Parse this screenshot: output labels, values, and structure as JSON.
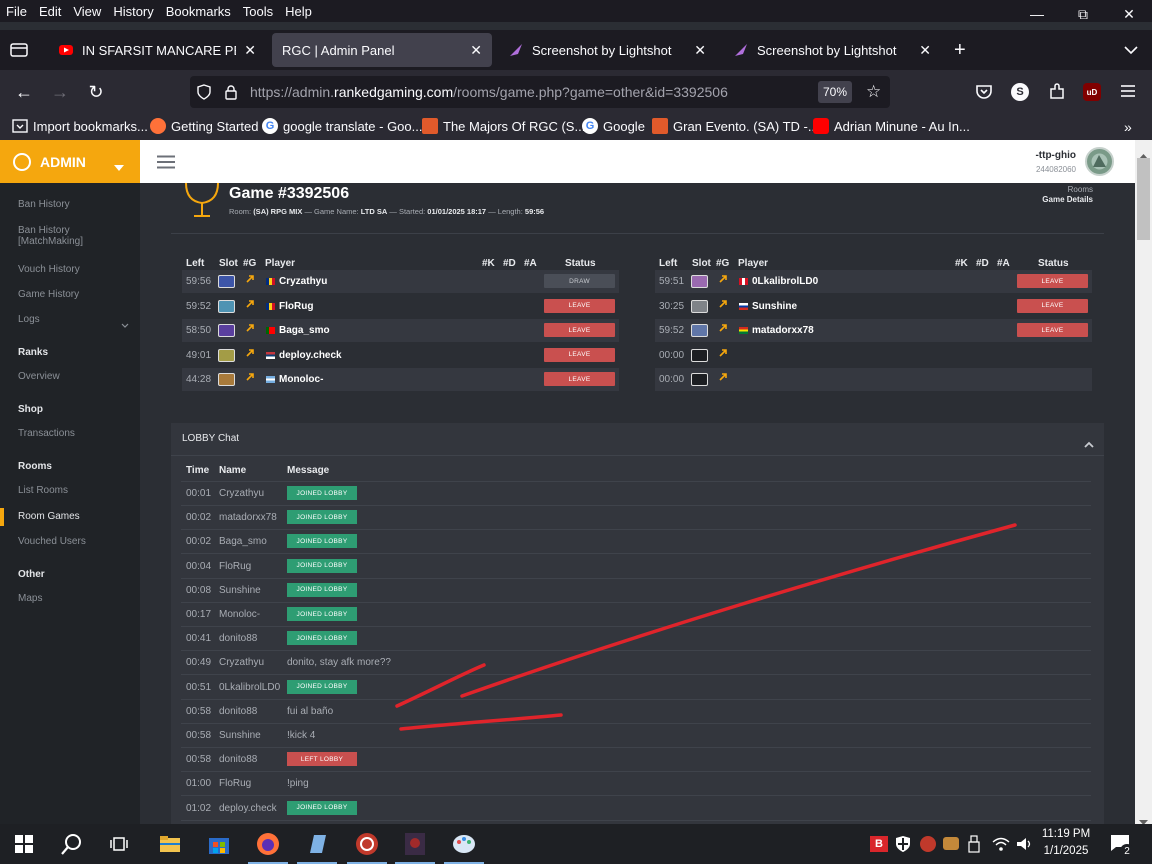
{
  "menubar": {
    "items": [
      "File",
      "Edit",
      "View",
      "History",
      "Bookmarks",
      "Tools",
      "Help"
    ]
  },
  "tabs": [
    {
      "label": "IN SFARSIT MANCARE PESTE M",
      "icon": "youtube-icon"
    },
    {
      "label": "RGC | Admin Panel",
      "icon": "none",
      "active": true
    },
    {
      "label": "Screenshot by Lightshot",
      "icon": "lightshot-icon"
    },
    {
      "label": "Screenshot by Lightshot",
      "icon": "lightshot-icon"
    }
  ],
  "url": {
    "prefix": "https://admin.",
    "host": "rankedgaming.com",
    "path": "/rooms/game.php?game=other&id=3392506",
    "zoom": "70%"
  },
  "toolbar": {
    "profile_initial": "S"
  },
  "bookmarks": [
    {
      "label": "Import bookmarks...",
      "icon": "import-icon",
      "color": "#fbfbfe"
    },
    {
      "label": "Getting Started",
      "icon": "firefox-icon",
      "color": "#ff7139"
    },
    {
      "label": "google translate - Goo...",
      "icon": "google-icon",
      "color": "#4285f4"
    },
    {
      "label": "The Majors Of RGC (S...",
      "icon": "rgc-icon",
      "color": "#e05a2b"
    },
    {
      "label": "Google",
      "icon": "google-icon",
      "color": "#4285f4"
    },
    {
      "label": "Gran Evento. (SA) TD -...",
      "icon": "rgc-icon",
      "color": "#e05a2b"
    },
    {
      "label": "Adrian Minune - Au In...",
      "icon": "youtube-icon",
      "color": "#ff0000"
    }
  ],
  "sidebar": {
    "brand": "ADMIN",
    "items": [
      {
        "label": "Ban History",
        "type": "item"
      },
      {
        "label": "Ban History",
        "label2": "[MatchMaking]",
        "type": "item"
      },
      {
        "label": "Vouch History",
        "type": "item"
      },
      {
        "label": "Game History",
        "type": "item"
      },
      {
        "label": "Logs",
        "type": "item"
      },
      {
        "label": "Ranks",
        "type": "head"
      },
      {
        "label": "Overview",
        "type": "item"
      },
      {
        "label": "Shop",
        "type": "head"
      },
      {
        "label": "Transactions",
        "type": "item"
      },
      {
        "label": "Rooms",
        "type": "head"
      },
      {
        "label": "List Rooms",
        "type": "item"
      },
      {
        "label": "Room Games",
        "type": "item",
        "active": true
      },
      {
        "label": "Vouched Users",
        "type": "item"
      },
      {
        "label": "Other",
        "type": "head"
      },
      {
        "label": "Maps",
        "type": "item"
      }
    ]
  },
  "user": {
    "name": "-ttp-ghio",
    "id": "244082060"
  },
  "breadcrumb": {
    "parent": "Rooms",
    "current": "Game Details"
  },
  "game": {
    "title": "Game #3392506",
    "room_label": "Room:",
    "room": "(SA) RPG MIX",
    "name_label": "Game Name:",
    "name": "LTD SA",
    "started_label": "Started:",
    "started": "01/01/2025 18:17",
    "length_label": "Length:",
    "length": "59:56"
  },
  "table_headers": {
    "left": "Left",
    "slot": "Slot",
    "g": "#G",
    "player": "Player",
    "k": "#K",
    "d": "#D",
    "a": "#A",
    "status": "Status"
  },
  "team1": [
    {
      "left": "59:56",
      "slot_color": "#3d55a8",
      "flag": "ro",
      "player": "Cryzathyu",
      "status": "DRAW"
    },
    {
      "left": "59:52",
      "slot_color": "#4e93b3",
      "flag": "ro",
      "player": "FloRug",
      "status": "LEAVE"
    },
    {
      "left": "58:50",
      "slot_color": "#5a3f9e",
      "flag": "pt",
      "player": "Baga_smo",
      "status": "LEAVE"
    },
    {
      "left": "49:01",
      "slot_color": "#a39c46",
      "flag": "rs",
      "player": "deploy.check",
      "status": "LEAVE"
    },
    {
      "left": "44:28",
      "slot_color": "#a87a3b",
      "flag": "ar",
      "player": "Monoloc-",
      "status": "LEAVE"
    }
  ],
  "team2": [
    {
      "left": "59:51",
      "slot_color": "#9a6ab0",
      "flag": "pe",
      "player": "0LkalibrolLD0",
      "status": "LEAVE"
    },
    {
      "left": "30:25",
      "slot_color": "#7f8388",
      "flag": "ru",
      "player": "Sunshine",
      "status": "LEAVE"
    },
    {
      "left": "59:52",
      "slot_color": "#6076a8",
      "flag": "bo",
      "player": "matadorxx78",
      "status": "LEAVE"
    },
    {
      "left": "00:00",
      "slot_color": "#1c1e22",
      "flag": "",
      "player": "",
      "status": ""
    },
    {
      "left": "00:00",
      "slot_color": "#1c1e22",
      "flag": "",
      "player": "",
      "status": ""
    }
  ],
  "lobby": {
    "title": "LOBBY Chat",
    "headers": {
      "time": "Time",
      "name": "Name",
      "message": "Message"
    },
    "rows": [
      {
        "time": "00:01",
        "name": "Cryzathyu",
        "type": "joined",
        "message": "JOINED LOBBY"
      },
      {
        "time": "00:02",
        "name": "matadorxx78",
        "type": "joined",
        "message": "JOINED LOBBY"
      },
      {
        "time": "00:02",
        "name": "Baga_smo",
        "type": "joined",
        "message": "JOINED LOBBY"
      },
      {
        "time": "00:04",
        "name": "FloRug",
        "type": "joined",
        "message": "JOINED LOBBY"
      },
      {
        "time": "00:08",
        "name": "Sunshine",
        "type": "joined",
        "message": "JOINED LOBBY"
      },
      {
        "time": "00:17",
        "name": "Monoloc-",
        "type": "joined",
        "message": "JOINED LOBBY"
      },
      {
        "time": "00:41",
        "name": "donito88",
        "type": "joined",
        "message": "JOINED LOBBY"
      },
      {
        "time": "00:49",
        "name": "Cryzathyu",
        "type": "text",
        "message": "donito, stay afk more??"
      },
      {
        "time": "00:51",
        "name": "0LkalibrolLD0",
        "type": "joined",
        "message": "JOINED LOBBY"
      },
      {
        "time": "00:58",
        "name": "donito88",
        "type": "text",
        "message": "fui al baño"
      },
      {
        "time": "00:58",
        "name": "Sunshine",
        "type": "text",
        "message": "!kick 4"
      },
      {
        "time": "00:58",
        "name": "donito88",
        "type": "left",
        "message": "LEFT LOBBY"
      },
      {
        "time": "01:00",
        "name": "FloRug",
        "type": "text",
        "message": "!ping"
      },
      {
        "time": "01:02",
        "name": "deploy.check",
        "type": "joined",
        "message": "JOINED LOBBY"
      }
    ]
  },
  "taskbar": {
    "time": "11:19 PM",
    "date": "1/1/2025",
    "notification_count": "2"
  },
  "colors": {
    "accent": "#f5a70e",
    "leave": "#c9504f",
    "joined": "#2e9d73",
    "annotation": "#e0242b"
  }
}
